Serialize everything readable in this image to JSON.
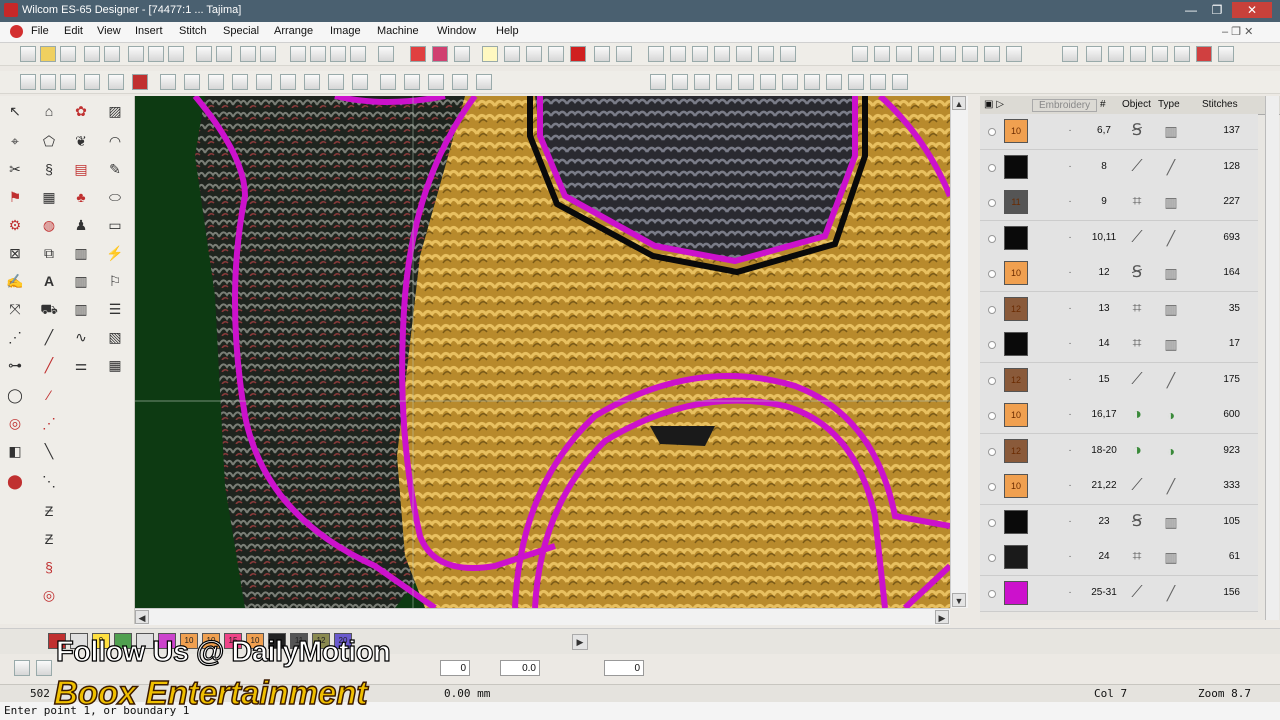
{
  "window": {
    "title": "Wilcom ES-65 Designer - [74477:1 ...  Tajima]",
    "min": "—",
    "max": "❐",
    "close": "✕"
  },
  "menu": [
    "File",
    "Edit",
    "View",
    "Insert",
    "Stitch",
    "Special",
    "Arrange",
    "Image",
    "Machine",
    "Window",
    "Help"
  ],
  "panel": {
    "tab_label": "Embroidery",
    "headers": {
      "hash": "#",
      "object": "Object",
      "type": "Type",
      "stitches": "Stitches"
    },
    "rows": [
      {
        "swatch": "#f0a050",
        "label": "10",
        "num": "6,7",
        "stitches": "137",
        "obj": "satin",
        "type": "fill"
      },
      {
        "swatch": "#0a0a0a",
        "label": "",
        "num": "8",
        "stitches": "128",
        "obj": "run",
        "type": "line"
      },
      {
        "swatch": "#555555",
        "label": "11",
        "num": "9",
        "stitches": "227",
        "obj": "complex",
        "type": "fill"
      },
      {
        "swatch": "#0a0a0a",
        "label": "",
        "num": "10,11",
        "stitches": "693",
        "obj": "run",
        "type": "line"
      },
      {
        "swatch": "#f0a050",
        "label": "10",
        "num": "12",
        "stitches": "164",
        "obj": "satin",
        "type": "fill"
      },
      {
        "swatch": "#8a5a3a",
        "label": "12",
        "num": "13",
        "stitches": "35",
        "obj": "complex",
        "type": "fill"
      },
      {
        "swatch": "#0a0a0a",
        "label": "",
        "num": "14",
        "stitches": "17",
        "obj": "complex",
        "type": "fill"
      },
      {
        "swatch": "#8a5a3a",
        "label": "12",
        "num": "15",
        "stitches": "175",
        "obj": "run",
        "type": "line"
      },
      {
        "swatch": "#f0a050",
        "label": "10",
        "num": "16,17",
        "stitches": "600",
        "obj": "color",
        "type": "color"
      },
      {
        "swatch": "#8a5a3a",
        "label": "12",
        "num": "18-20",
        "stitches": "923",
        "obj": "color",
        "type": "color"
      },
      {
        "swatch": "#f0a050",
        "label": "10",
        "num": "21,22",
        "stitches": "333",
        "obj": "run",
        "type": "line"
      },
      {
        "swatch": "#0a0a0a",
        "label": "",
        "num": "23",
        "stitches": "105",
        "obj": "satin",
        "type": "fill"
      },
      {
        "swatch": "#1a1a1a",
        "label": "",
        "num": "24",
        "stitches": "61",
        "obj": "complex",
        "type": "fill"
      },
      {
        "swatch": "#cc11cc",
        "label": "",
        "num": "25-31",
        "stitches": "156",
        "obj": "run",
        "type": "line"
      }
    ]
  },
  "colorbar": [
    {
      "c": "#c03030",
      "t": ""
    },
    {
      "c": "#e0e0e0",
      "t": ""
    },
    {
      "c": "#ffe040",
      "t": "9"
    },
    {
      "c": "#50a050",
      "t": ""
    },
    {
      "c": "#e0e0e0",
      "t": ""
    },
    {
      "c": "#cc44cc",
      "t": ""
    },
    {
      "c": "#f0a050",
      "t": "10"
    },
    {
      "c": "#f0a050",
      "t": "10"
    },
    {
      "c": "#ee4488",
      "t": "15"
    },
    {
      "c": "#f0a050",
      "t": "10"
    },
    {
      "c": "#222222",
      "t": ""
    },
    {
      "c": "#555555",
      "t": "11"
    },
    {
      "c": "#8a8a50",
      "t": "12"
    },
    {
      "c": "#6a5acd",
      "t": "20"
    }
  ],
  "options": {
    "field1": "0",
    "field2": "0.0",
    "field3": "0"
  },
  "status": {
    "left": "502",
    "length": "0.00 mm",
    "col": "Col 7",
    "zoom": "Zoom 8.7"
  },
  "prompt": "Enter point 1, or boundary 1",
  "watermark": {
    "line1": "Follow Us @ DailyMotion",
    "line2": "Boox Entertainment"
  }
}
